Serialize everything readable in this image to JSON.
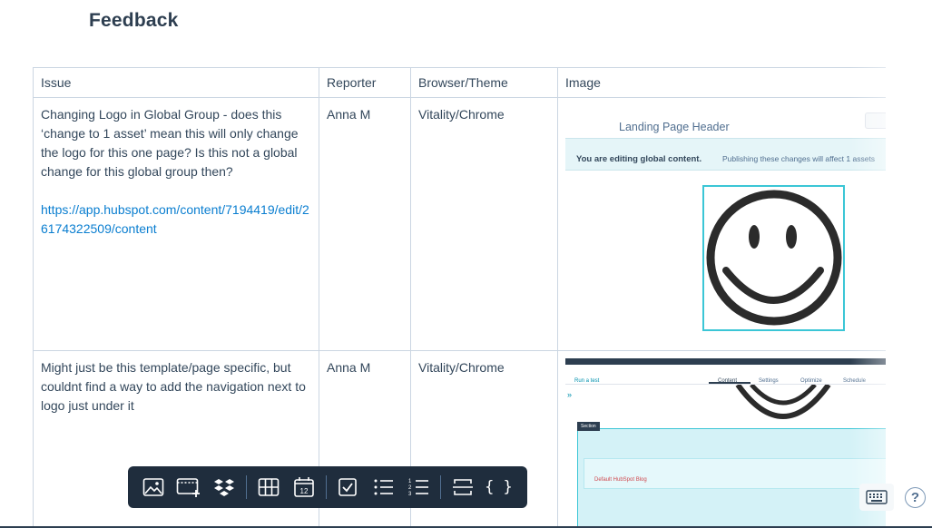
{
  "page": {
    "title": "Feedback"
  },
  "table": {
    "headers": [
      "Issue",
      "Reporter",
      "Browser/Theme",
      "Image"
    ],
    "rows": [
      {
        "issue": "Changing Logo in Global Group - does this ‘change to 1 asset’ mean this will only change the logo for this one page? Is this not a global change for this global group then?",
        "link": "https://app.hubspot.com/content/7194419/edit/26174322509/content",
        "reporter": "Anna M",
        "browser": "Vitality/Chrome",
        "image": {
          "header": "Landing Page Header",
          "banner_bold": "You are editing global content.",
          "banner_rest": "Publishing these changes will affect 1 assets",
          "content": "smiley-face-logo"
        }
      },
      {
        "issue": "Might just be this template/page specific, but couldnt find a way to add the navigation next to logo just under it",
        "reporter": "Anna M",
        "browser": "Vitality/Chrome",
        "image": {
          "run_test": "Run a test",
          "tabs": [
            "Content",
            "Settings",
            "Optimize",
            "Schedule"
          ],
          "section_label": "Section",
          "blog_item": "Default HubSpot Blog"
        }
      }
    ]
  },
  "toolbar": {
    "buttons": [
      "image-icon",
      "embed-icon",
      "dropbox-icon",
      "table-icon",
      "calendar-icon",
      "checkbox-icon",
      "bulleted-list-icon",
      "numbered-list-icon",
      "divider-icon",
      "code-block-icon"
    ],
    "calendar_day": "12",
    "code_label": "{ }"
  },
  "help": {
    "label": "?"
  },
  "colors": {
    "toolbar_bg": "#1f2d3d",
    "link": "#0a7ed0",
    "border": "#cbd6e2",
    "accent": "#3bc6d6"
  }
}
